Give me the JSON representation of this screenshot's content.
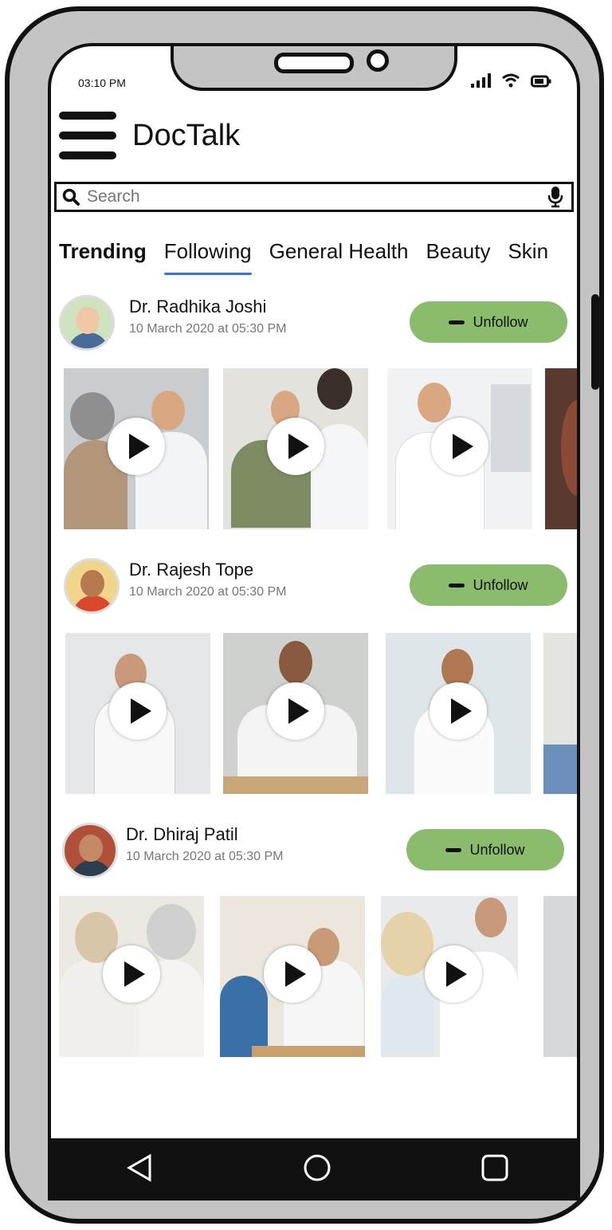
{
  "status": {
    "time": "03:10 PM"
  },
  "app": {
    "title": "DocTalk"
  },
  "search": {
    "placeholder": "Search"
  },
  "tabs": [
    "Trending",
    "Following",
    "General Health",
    "Beauty",
    "Skin"
  ],
  "doctors": [
    {
      "name": "Dr. Radhika Joshi",
      "date": "10 March 2020 at 05:30 PM",
      "button": "Unfollow"
    },
    {
      "name": "Dr. Rajesh Tope",
      "date": "10 March 2020 at 05:30 PM",
      "button": "Unfollow"
    },
    {
      "name": "Dr. Dhiraj Patil",
      "date": "10 March 2020 at 05:30 PM",
      "button": "Unfollow"
    }
  ],
  "icons": {
    "menu": "hamburger-menu-icon",
    "search": "search-icon",
    "mic": "microphone-icon",
    "play": "play-icon",
    "back": "back-triangle-icon",
    "home": "home-circle-icon",
    "recents": "recents-square-icon"
  },
  "colors": {
    "accent": "#3b6fd8",
    "button": "#8bbc6e"
  }
}
